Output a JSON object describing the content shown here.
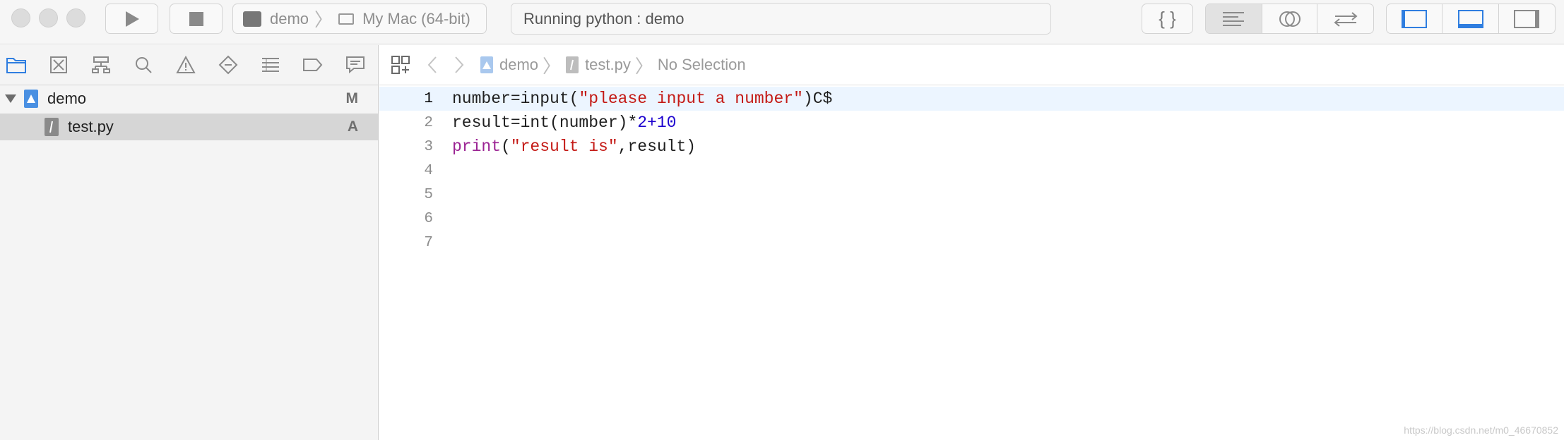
{
  "toolbar": {
    "scheme": {
      "project": "demo",
      "destination": "My Mac (64-bit)"
    },
    "status": "Running python : demo",
    "editor_toggle_glyph": "{ }"
  },
  "navigator": {
    "tabs": [
      "project-navigator",
      "source-control-navigator",
      "symbol-navigator",
      "find-navigator",
      "issue-navigator",
      "test-navigator",
      "debug-navigator",
      "breakpoint-navigator",
      "report-navigator"
    ],
    "tree": [
      {
        "name": "demo",
        "badge": "M"
      },
      {
        "name": "test.py",
        "badge": "A"
      }
    ]
  },
  "jumpbar": {
    "project": "demo",
    "file": "test.py",
    "selection": "No Selection"
  },
  "editor": {
    "lines": [
      "1",
      "2",
      "3",
      "4",
      "5",
      "6",
      "7"
    ],
    "code": {
      "l1": {
        "a": "number=input(",
        "b": "\"please input a number\"",
        "c": ")C$"
      },
      "l2": {
        "a": "result=int(number)*",
        "b": "2+10"
      },
      "l3": {
        "a": "print",
        "b": "(",
        "c": "\"result is\"",
        "d": ",result)"
      }
    }
  },
  "watermark": "https://blog.csdn.net/m0_46670852",
  "colors": {
    "accent": "#2f7ee0",
    "string": "#c41a16",
    "number": "#1c00cf",
    "keyword": "#9b2393",
    "current_line": "#ecf5ff"
  }
}
